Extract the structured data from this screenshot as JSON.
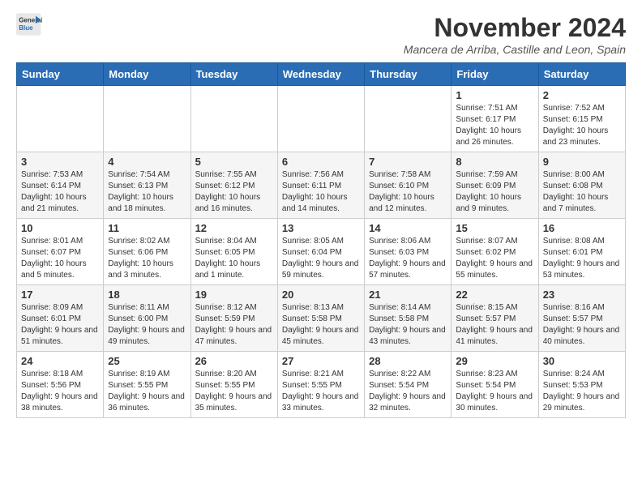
{
  "header": {
    "logo": {
      "general": "General",
      "blue": "Blue"
    },
    "title": "November 2024",
    "subtitle": "Mancera de Arriba, Castille and Leon, Spain"
  },
  "weekdays": [
    "Sunday",
    "Monday",
    "Tuesday",
    "Wednesday",
    "Thursday",
    "Friday",
    "Saturday"
  ],
  "weeks": [
    [
      {
        "day": "",
        "info": ""
      },
      {
        "day": "",
        "info": ""
      },
      {
        "day": "",
        "info": ""
      },
      {
        "day": "",
        "info": ""
      },
      {
        "day": "",
        "info": ""
      },
      {
        "day": "1",
        "info": "Sunrise: 7:51 AM\nSunset: 6:17 PM\nDaylight: 10 hours and 26 minutes."
      },
      {
        "day": "2",
        "info": "Sunrise: 7:52 AM\nSunset: 6:15 PM\nDaylight: 10 hours and 23 minutes."
      }
    ],
    [
      {
        "day": "3",
        "info": "Sunrise: 7:53 AM\nSunset: 6:14 PM\nDaylight: 10 hours and 21 minutes."
      },
      {
        "day": "4",
        "info": "Sunrise: 7:54 AM\nSunset: 6:13 PM\nDaylight: 10 hours and 18 minutes."
      },
      {
        "day": "5",
        "info": "Sunrise: 7:55 AM\nSunset: 6:12 PM\nDaylight: 10 hours and 16 minutes."
      },
      {
        "day": "6",
        "info": "Sunrise: 7:56 AM\nSunset: 6:11 PM\nDaylight: 10 hours and 14 minutes."
      },
      {
        "day": "7",
        "info": "Sunrise: 7:58 AM\nSunset: 6:10 PM\nDaylight: 10 hours and 12 minutes."
      },
      {
        "day": "8",
        "info": "Sunrise: 7:59 AM\nSunset: 6:09 PM\nDaylight: 10 hours and 9 minutes."
      },
      {
        "day": "9",
        "info": "Sunrise: 8:00 AM\nSunset: 6:08 PM\nDaylight: 10 hours and 7 minutes."
      }
    ],
    [
      {
        "day": "10",
        "info": "Sunrise: 8:01 AM\nSunset: 6:07 PM\nDaylight: 10 hours and 5 minutes."
      },
      {
        "day": "11",
        "info": "Sunrise: 8:02 AM\nSunset: 6:06 PM\nDaylight: 10 hours and 3 minutes."
      },
      {
        "day": "12",
        "info": "Sunrise: 8:04 AM\nSunset: 6:05 PM\nDaylight: 10 hours and 1 minute."
      },
      {
        "day": "13",
        "info": "Sunrise: 8:05 AM\nSunset: 6:04 PM\nDaylight: 9 hours and 59 minutes."
      },
      {
        "day": "14",
        "info": "Sunrise: 8:06 AM\nSunset: 6:03 PM\nDaylight: 9 hours and 57 minutes."
      },
      {
        "day": "15",
        "info": "Sunrise: 8:07 AM\nSunset: 6:02 PM\nDaylight: 9 hours and 55 minutes."
      },
      {
        "day": "16",
        "info": "Sunrise: 8:08 AM\nSunset: 6:01 PM\nDaylight: 9 hours and 53 minutes."
      }
    ],
    [
      {
        "day": "17",
        "info": "Sunrise: 8:09 AM\nSunset: 6:01 PM\nDaylight: 9 hours and 51 minutes."
      },
      {
        "day": "18",
        "info": "Sunrise: 8:11 AM\nSunset: 6:00 PM\nDaylight: 9 hours and 49 minutes."
      },
      {
        "day": "19",
        "info": "Sunrise: 8:12 AM\nSunset: 5:59 PM\nDaylight: 9 hours and 47 minutes."
      },
      {
        "day": "20",
        "info": "Sunrise: 8:13 AM\nSunset: 5:58 PM\nDaylight: 9 hours and 45 minutes."
      },
      {
        "day": "21",
        "info": "Sunrise: 8:14 AM\nSunset: 5:58 PM\nDaylight: 9 hours and 43 minutes."
      },
      {
        "day": "22",
        "info": "Sunrise: 8:15 AM\nSunset: 5:57 PM\nDaylight: 9 hours and 41 minutes."
      },
      {
        "day": "23",
        "info": "Sunrise: 8:16 AM\nSunset: 5:57 PM\nDaylight: 9 hours and 40 minutes."
      }
    ],
    [
      {
        "day": "24",
        "info": "Sunrise: 8:18 AM\nSunset: 5:56 PM\nDaylight: 9 hours and 38 minutes."
      },
      {
        "day": "25",
        "info": "Sunrise: 8:19 AM\nSunset: 5:55 PM\nDaylight: 9 hours and 36 minutes."
      },
      {
        "day": "26",
        "info": "Sunrise: 8:20 AM\nSunset: 5:55 PM\nDaylight: 9 hours and 35 minutes."
      },
      {
        "day": "27",
        "info": "Sunrise: 8:21 AM\nSunset: 5:55 PM\nDaylight: 9 hours and 33 minutes."
      },
      {
        "day": "28",
        "info": "Sunrise: 8:22 AM\nSunset: 5:54 PM\nDaylight: 9 hours and 32 minutes."
      },
      {
        "day": "29",
        "info": "Sunrise: 8:23 AM\nSunset: 5:54 PM\nDaylight: 9 hours and 30 minutes."
      },
      {
        "day": "30",
        "info": "Sunrise: 8:24 AM\nSunset: 5:53 PM\nDaylight: 9 hours and 29 minutes."
      }
    ]
  ]
}
